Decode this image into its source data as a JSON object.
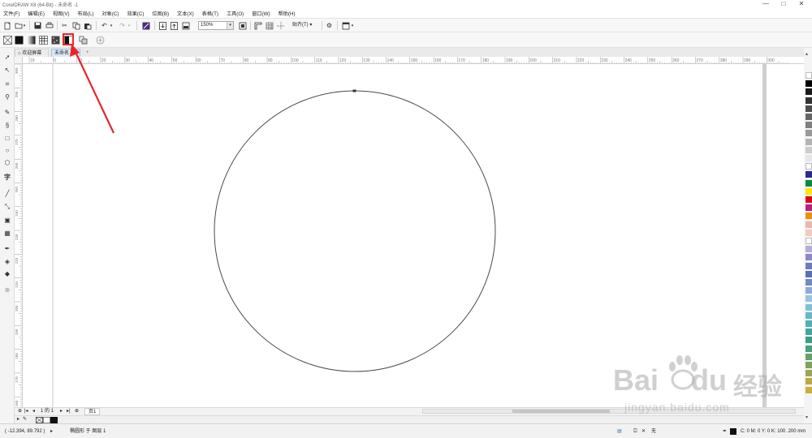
{
  "window": {
    "title": "CorelDRAW X8 (64-Bit) - 未命名 -1",
    "minimize": "—",
    "maximize": "□",
    "close": "✕"
  },
  "menu": [
    "文件(F)",
    "编辑(E)",
    "视图(V)",
    "布局(L)",
    "对象(C)",
    "效果(C)",
    "位图(B)",
    "文本(X)",
    "表格(T)",
    "工具(O)",
    "窗口(W)",
    "帮助(H)"
  ],
  "toolbar": {
    "zoom_value": "150%",
    "snap_label": "贴齐(T)",
    "icons": [
      "new-icon",
      "open-icon",
      "save-icon",
      "print-icon",
      "cut-icon",
      "copy-icon",
      "paste-icon",
      "undo-icon",
      "redo-icon",
      "search-content-icon",
      "import-icon",
      "export-icon",
      "publish-pdf-icon",
      "zoom-dropdown",
      "fullscreen-icon",
      "rulers-icon",
      "grids-icon",
      "guidelines-icon",
      "snap-dropdown",
      "options-icon",
      "launch-icon"
    ]
  },
  "property_bar": {
    "icons": [
      "no-fill-icon",
      "uniform-fill-icon",
      "fountain-fill-icon",
      "pattern-fill-icon",
      "texture-fill-icon",
      "postscript-fill-icon",
      "copy-fill-icon",
      "edit-fill-icon"
    ]
  },
  "tabs": {
    "welcome": "欢迎屏幕",
    "document": "未命名 -1",
    "add": "+"
  },
  "ruler": {
    "h_labels": [
      "10",
      "0",
      "10",
      "20",
      "30",
      "40",
      "50",
      "60",
      "70",
      "80",
      "90",
      "100",
      "110",
      "120",
      "130",
      "140",
      "150",
      "160",
      "170",
      "180",
      "190",
      "200",
      "210",
      "220",
      "230",
      "240",
      "250",
      "260",
      "270",
      "280",
      "290",
      "300"
    ],
    "v_labels": [
      "300",
      "290",
      "280",
      "270",
      "260",
      "250",
      "240",
      "230",
      "220",
      "210",
      "200",
      "190",
      "180",
      "170",
      "160",
      "150",
      "140",
      "130",
      "120",
      "110"
    ]
  },
  "page_nav": {
    "page_count": "1 的 1",
    "page_tab": "页1"
  },
  "status": {
    "coords": "( -12.394, 89.792 )",
    "selection": "椭圆形 于 图层 1",
    "fill_none": "无",
    "outline": "C: 0 M: 0 Y: 0 K: 100  .200 mm"
  },
  "watermark": {
    "brand_a": "Bai",
    "brand_b": "du",
    "brand_c": "经验",
    "url": "jingyan.baidu.com"
  },
  "palette_colors": [
    "#ffffff",
    "#000000",
    "#1a1a1a",
    "#333333",
    "#4d4d4d",
    "#666666",
    "#808080",
    "#999999",
    "#b3b3b3",
    "#cccccc",
    "#e6e6e6",
    "#ffffff",
    "#2b2b8c",
    "#0a8a3e",
    "#ffe600",
    "#e2001a",
    "#c21b7d",
    "#f18d00",
    "#e8b7b0",
    "#f4c9c3",
    "#ffffff",
    "#b6aed6",
    "#8e89c4",
    "#6f7bb9",
    "#5a6eb2",
    "#7389c5",
    "#8fa9d8",
    "#9bc2e5",
    "#7fc0d8",
    "#65b7c9",
    "#4fb0b3",
    "#3ea79c",
    "#3a9e85",
    "#4aa07a",
    "#62a16d",
    "#7ea35e",
    "#9aa652",
    "#b6aa47",
    "#ccae3d"
  ],
  "annotation": {
    "arrow_color": "#e8262a"
  }
}
